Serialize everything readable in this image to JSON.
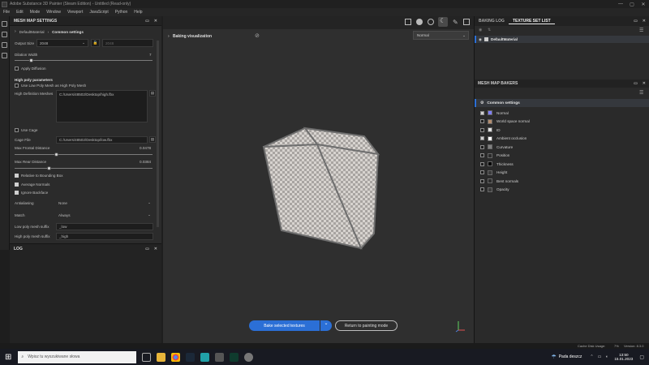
{
  "window": {
    "title": "Adobe Substance 3D Painter (Steam Edition) - Untitled (Read-only)",
    "controls": [
      "—",
      "▢",
      "✕"
    ]
  },
  "menu": [
    "File",
    "Edit",
    "Mode",
    "Window",
    "Viewport",
    "JavaScript",
    "Python",
    "Help"
  ],
  "mesh_map_settings": {
    "panel_title": "MESH MAP SETTINGS",
    "crumb_material": "DefaultMaterial",
    "crumb_section": "Common settings",
    "output_size_label": "Output Size",
    "output_size_value": "2048",
    "output_size_locked": "2048",
    "dilation_label": "Dilation Width",
    "dilation_value": "7",
    "dilation_level": 0.12,
    "apply_diffusion_label": "Apply Diffusion",
    "high_poly_heading": "High poly parameters",
    "use_low_as_high_label": "Use Low Poly Mesh as High Poly Mesh",
    "high_def_meshes_label": "High Definition Meshes",
    "high_def_meshes_value": "C:/Users/48502/Desktop/high.fbx",
    "use_cage_label": "Use Cage",
    "cage_file_label": "Cage File",
    "cage_file_value": "C:/Users/48502/Desktop/low.fbx",
    "max_frontal_label": "Max Frontal Distance",
    "max_frontal_value": "0.0478",
    "max_frontal_level": 0.3,
    "max_rear_label": "Max Rear Distance",
    "max_rear_value": "0.0384",
    "max_rear_level": 0.25,
    "relative_bbox_label": "Relative to Bounding Box",
    "average_normals_label": "Average Normals",
    "ignore_backface_label": "Ignore Backface",
    "antialiasing_label": "Antialiasing",
    "antialiasing_value": "None",
    "match_label": "Match",
    "match_value": "Always",
    "low_suffix_label": "Low poly mesh suffix",
    "low_suffix_value": "_low",
    "high_suffix_label": "High poly mesh suffix",
    "high_suffix_value": "_high"
  },
  "log": {
    "title": "LOG"
  },
  "viewport": {
    "title": "Baking visualization",
    "channel_select": "Normal",
    "bake_button": "Bake selected textures",
    "return_button": "Return to painting mode"
  },
  "right": {
    "tab_baking_log": "BAKING LOG",
    "tab_texture_set_list": "TEXTURE SET LIST",
    "texture_set_item": "DefaultMaterial",
    "bakers_title": "MESH MAP BAKERS",
    "common_settings": "Common settings",
    "bakers": [
      {
        "label": "Normal",
        "checked": true,
        "swatch": "#7f7fff"
      },
      {
        "label": "World space normal",
        "checked": false,
        "swatch": "#b38c6e"
      },
      {
        "label": "ID",
        "checked": false,
        "swatch": "#e0e0e0"
      },
      {
        "label": "Ambient occlusion",
        "checked": true,
        "swatch": "#ffffff"
      },
      {
        "label": "Curvature",
        "checked": false,
        "swatch": "#808080"
      },
      {
        "label": "Position",
        "checked": false,
        "swatch": "#2b2b2b"
      },
      {
        "label": "Thickness",
        "checked": false,
        "swatch": "#000000"
      },
      {
        "label": "Height",
        "checked": false,
        "swatch": "#3a3a3a"
      },
      {
        "label": "Bent normals",
        "checked": false,
        "swatch": "#2b2b2b"
      },
      {
        "label": "Opacity",
        "checked": false,
        "swatch": "#3a3a3a"
      }
    ]
  },
  "status": {
    "cache_label": "Cache Disk Usage:",
    "cache_value": "7%",
    "version": "Version: 8.3.0"
  },
  "taskbar": {
    "search_placeholder": "Wpisz tu wyszukiwane słowa",
    "weather": "Pada deszcz",
    "time": "13:50",
    "date": "15.01.2023"
  },
  "colors": {
    "accent": "#2b6fd6",
    "panel": "#2b2b2b",
    "viewport": "#2f2f2f"
  }
}
